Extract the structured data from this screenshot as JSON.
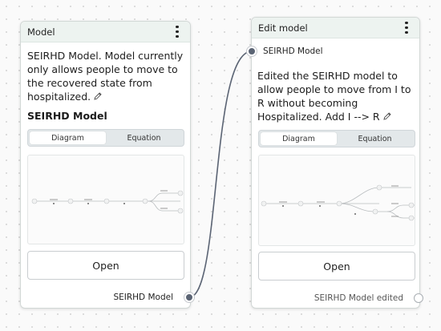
{
  "node1": {
    "title": "Model",
    "description": "SEIRHD Model. Model currently only allows people to move to the recovered state from hospitalized.",
    "model_name": "SEIRHD Model",
    "tabs": [
      "Diagram",
      "Equation"
    ],
    "active_tab": "Diagram",
    "open_label": "Open",
    "output_port_label": "SEIRHD Model"
  },
  "node2": {
    "title": "Edit model",
    "input_port_label": "SEIRHD Model",
    "description": "Edited the SEIRHD model to allow people to move from I to R without becoming Hospitalized. Add I --> R",
    "tabs": [
      "Diagram",
      "Equation"
    ],
    "active_tab": "Diagram",
    "open_label": "Open",
    "output_port_label": "SEIRHD Model edited"
  },
  "icons": [
    "kebab-menu-icon",
    "pencil-icon"
  ],
  "colors": {
    "header_bg": "#edf3f0",
    "port": "#5b6474",
    "edge": "#5b6474"
  }
}
